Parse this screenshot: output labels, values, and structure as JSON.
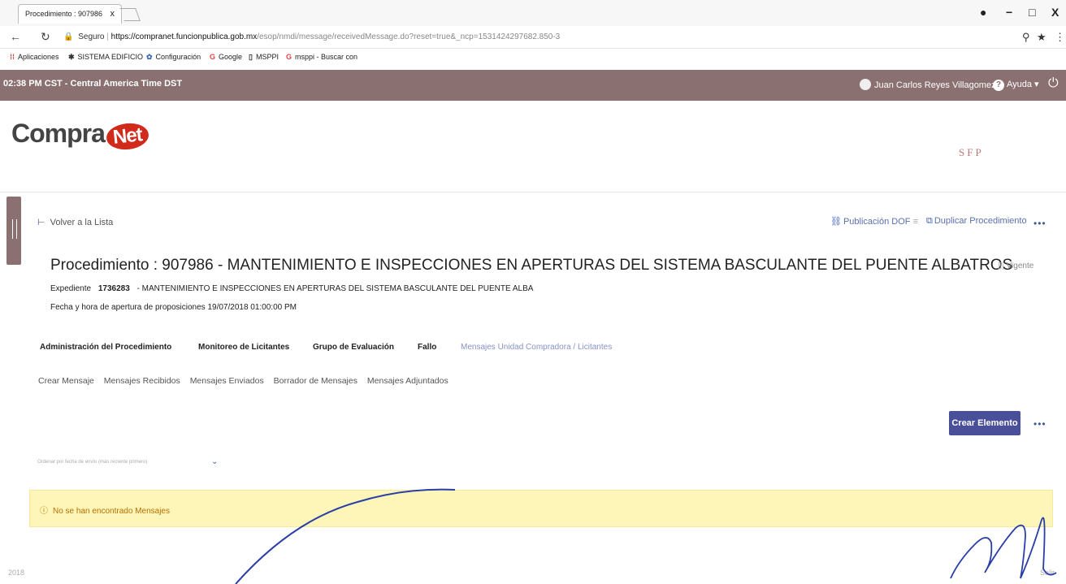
{
  "browser": {
    "tab_title": "Procedimiento : 907986",
    "tab_close": "x",
    "url_secure_label": "Seguro",
    "url_host": "https://compranet.funcionpublica.gob.mx",
    "url_path": "/esop/nmdi/message/receivedMessage.do?reset=true&_ncp=1531424297682.850-3",
    "window_controls": [
      "−",
      "□",
      "X"
    ],
    "bookmarks": [
      {
        "label": "Aplicaciones",
        "icon": "apps-grid-icon"
      },
      {
        "label": "SISTEMA EDIFICIO",
        "icon": "bookmark-icon"
      },
      {
        "label": "Configuración",
        "icon": "gear-icon"
      },
      {
        "label": "Google",
        "icon": "google-icon"
      },
      {
        "label": "MSPPI",
        "icon": "page-icon"
      },
      {
        "label": "msppi - Buscar con",
        "icon": "google-icon"
      }
    ]
  },
  "topbar": {
    "time": "02:38 PM CST - Central America Time DST",
    "user": "Juan Carlos Reyes Villagomez",
    "help": "Ayuda"
  },
  "logo": {
    "prefix": "Compra",
    "suffix": "Net",
    "agency": "SFP"
  },
  "header": {
    "back": "Volver a la Lista",
    "publicacion": "Publicación DOF",
    "duplicar": "Duplicar Procedimiento",
    "more": "•••"
  },
  "procedure": {
    "title": "Procedimiento : 907986 - MANTENIMIENTO E INSPECCIONES EN APERTURAS DEL SISTEMA BASCULANTE DEL PUENTE ALBATROS",
    "status": "Vigente",
    "expediente_label": "Expediente",
    "expediente_number": "1736283",
    "expediente_desc": "- MANTENIMIENTO E INSPECCIONES EN APERTURAS DEL SISTEMA BASCULANTE DEL PUENTE ALBA",
    "fecha": "Fecha y hora de apertura de proposiciones  19/07/2018 01:00:00 PM"
  },
  "tabs": [
    "Administración del Procedimiento",
    "Monitoreo de Licitantes",
    "Grupo de Evaluación",
    "Fallo",
    "Mensajes Unidad Compradora / Licitantes"
  ],
  "subnav": [
    "Crear Mensaje",
    "Mensajes Recibidos",
    "Mensajes Enviados",
    "Borrador de Mensajes",
    "Mensajes Adjuntados"
  ],
  "main": {
    "create_button": "Crear Elemento",
    "more": "•••",
    "filter_text": "Ordenar por fecha de envío (más reciente primero)",
    "alert": "No se han encontrado Mensajes",
    "footer_left": "2018",
    "footer_right": "Salir"
  }
}
